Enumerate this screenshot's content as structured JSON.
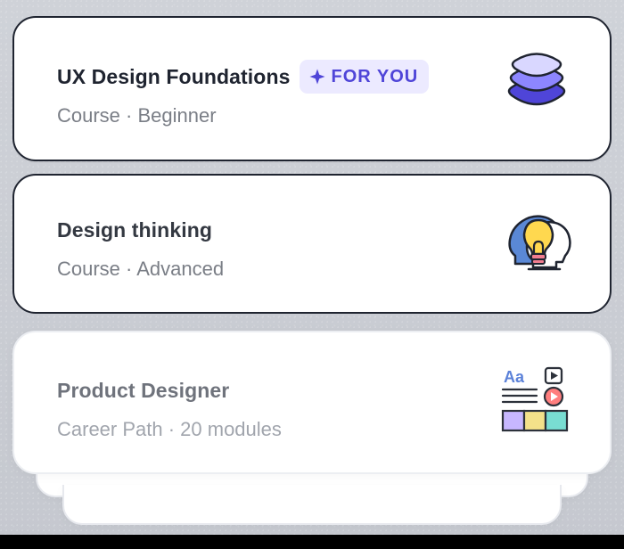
{
  "cards": [
    {
      "title": "UX Design Foundations",
      "badge": {
        "label": "FOR YOU",
        "icon": "sparkle-icon"
      },
      "subtitle": "Course · Beginner",
      "illustration": "layers-icon",
      "colors": {
        "top_layer": "#d9d7ff",
        "middle_layer": "#8d86ff",
        "bottom_layer": "#4f45d8",
        "outline": "#1f2430"
      }
    },
    {
      "title": "Design thinking",
      "subtitle": "Course · Advanced",
      "illustration": "idea-heads-icon",
      "colors": {
        "head_blue": "#5a88d6",
        "head_white": "#ffffff",
        "bulb": "#ffd84f",
        "base": "#f07d90",
        "outline": "#1f2430"
      }
    },
    {
      "title": "Product Designer",
      "subtitle": "Career Path · 20 modules",
      "illustration": "content-blocks-icon",
      "colors": {
        "text_blue": "#5c82d9",
        "play_red": "#ff7e7e",
        "purple": "#c7b7ff",
        "yellow": "#f3e18a",
        "teal": "#79ddd2",
        "outline": "#2c313a"
      }
    }
  ],
  "ui": {
    "overlay_tone": "#c9ccd3",
    "bottom_bar": "#000000"
  }
}
